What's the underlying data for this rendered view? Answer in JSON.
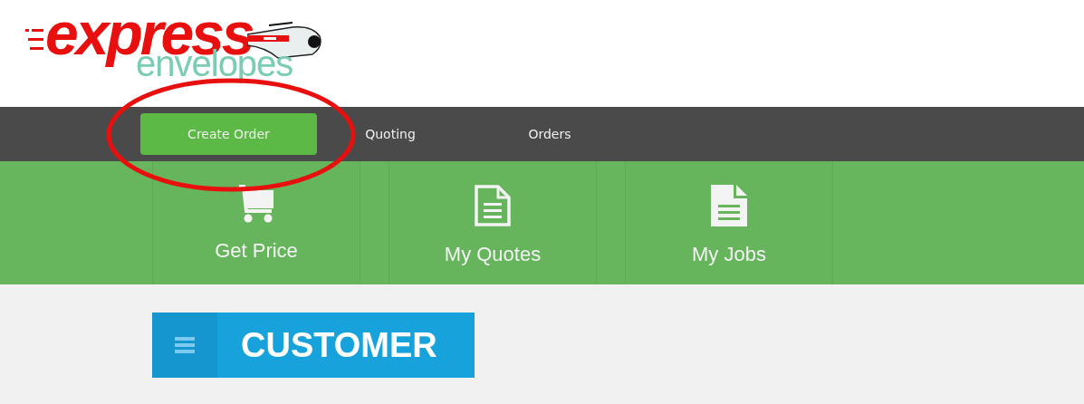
{
  "logo": {
    "word": "express",
    "subword": "envelopes"
  },
  "nav": [
    {
      "label": "Create Order",
      "selected": true
    },
    {
      "label": "Quoting",
      "selected": false
    },
    {
      "label": "Orders",
      "selected": false
    }
  ],
  "tiles": [
    {
      "label": "Get Price",
      "kind": "cart"
    },
    {
      "label": "My Quotes",
      "kind": "document-outline"
    },
    {
      "label": "My Jobs",
      "kind": "document"
    }
  ],
  "section": {
    "title": "CUSTOMER"
  },
  "annotation": {
    "kind": "ellipse"
  }
}
